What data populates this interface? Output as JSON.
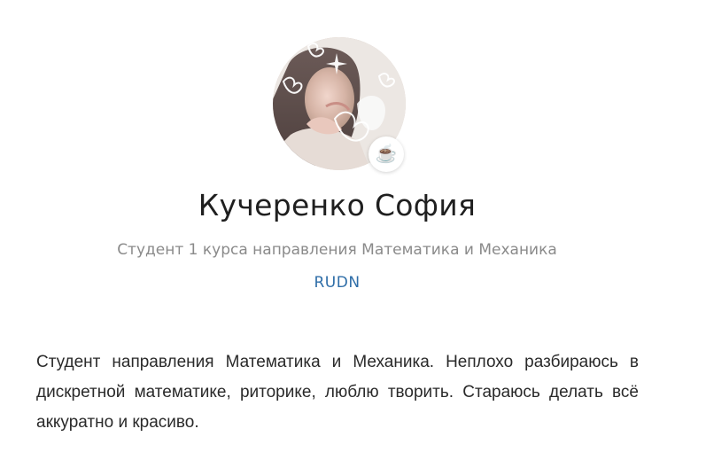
{
  "profile": {
    "name": "Кучеренко София",
    "subtitle": "Студент 1 курса направления Математика и Механика",
    "organization": "RUDN",
    "status_emoji": "☕",
    "bio": "Студент направления Математика и Механика. Неплохо разбираюсь в дискретной математике, риторике, люблю творить. Стараюсь делать всё аккуратно и красиво."
  },
  "colors": {
    "link": "#2f6ea8",
    "subtitle": "#8a8a8a",
    "name": "#1f1f1f"
  },
  "icons": {
    "status": "coffee-cup-icon"
  }
}
